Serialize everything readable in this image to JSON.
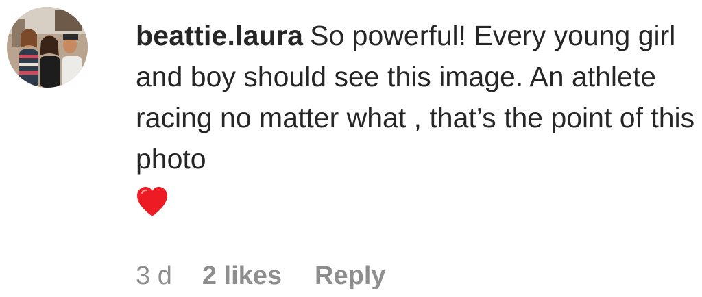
{
  "comment": {
    "username": "beattie.laura",
    "text": "So powerful! Every young girl and boy should see this image. An athlete racing no matter what , that’s the point of this photo",
    "emoji_icon": "red-heart-icon",
    "avatar_icon": "profile-photo-avatar",
    "time": "3 d",
    "likes": "2 likes",
    "reply_label": "Reply"
  },
  "colors": {
    "text": "#262626",
    "muted": "#8e8e8e",
    "heart": "#ed1c24"
  }
}
